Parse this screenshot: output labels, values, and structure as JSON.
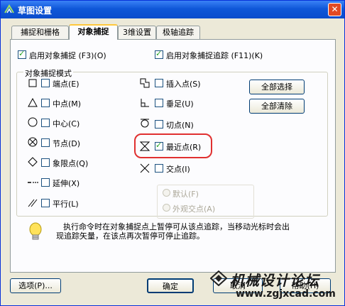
{
  "window": {
    "title": "草图设置",
    "close_symbol": "✕"
  },
  "tabs": [
    {
      "label": "捕捉和栅格",
      "active": false
    },
    {
      "label": "对象捕捉",
      "active": true
    },
    {
      "label": "3维设置",
      "active": false
    },
    {
      "label": "极轴追踪",
      "active": false
    }
  ],
  "top_options": {
    "enable_snap": {
      "label": "启用对象捕捉 (F3)(O)",
      "checked": true
    },
    "enable_tracking": {
      "label": "启用对象捕捉追踪 (F11)(K)",
      "checked": true
    }
  },
  "group_title": "对象捕捉模式",
  "snap_modes_left": [
    {
      "label": "端点(E)",
      "checked": false,
      "icon": "endpoint-square-icon"
    },
    {
      "label": "中点(M)",
      "checked": false,
      "icon": "midpoint-triangle-icon"
    },
    {
      "label": "中心(C)",
      "checked": false,
      "icon": "center-circle-icon"
    },
    {
      "label": "节点(D)",
      "checked": false,
      "icon": "node-x-circle-icon"
    },
    {
      "label": "象限点(Q)",
      "checked": false,
      "icon": "quadrant-diamond-icon"
    },
    {
      "label": "延伸(X)",
      "checked": false,
      "icon": "extension-dots-icon"
    },
    {
      "label": "平行(L)",
      "checked": false,
      "icon": "parallel-lines-icon"
    }
  ],
  "snap_modes_right": [
    {
      "label": "插入点(S)",
      "checked": false,
      "icon": "insert-icon"
    },
    {
      "label": "垂足(U)",
      "checked": false,
      "icon": "perpendicular-icon"
    },
    {
      "label": "切点(N)",
      "checked": false,
      "icon": "tangent-icon"
    },
    {
      "label": "最近点(R)",
      "checked": true,
      "icon": "nearest-hourglass-icon"
    },
    {
      "label": "交点(I)",
      "checked": false,
      "icon": "intersection-x-icon"
    }
  ],
  "buttons": {
    "select_all": "全部选择",
    "clear_all": "全部清除",
    "options": "选项(P)...",
    "ok": "确定",
    "cancel": "取消",
    "help": "帮助(H)"
  },
  "radios": [
    {
      "label": "默认(F)"
    },
    {
      "label": "外观交点(A)"
    }
  ],
  "hint": {
    "line1": "执行命令时在对象捕捉点上暂停可从该点追踪，当移动光标时会出",
    "line2": "现追踪矢量，在该点再次暂停可停止追踪。"
  },
  "watermark": {
    "text": "机械设计论坛",
    "url": "www.zgjxcad.com"
  },
  "colors": {
    "titlebar": "#0a4ccc",
    "highlight": "#e03030",
    "check": "#21a121"
  }
}
